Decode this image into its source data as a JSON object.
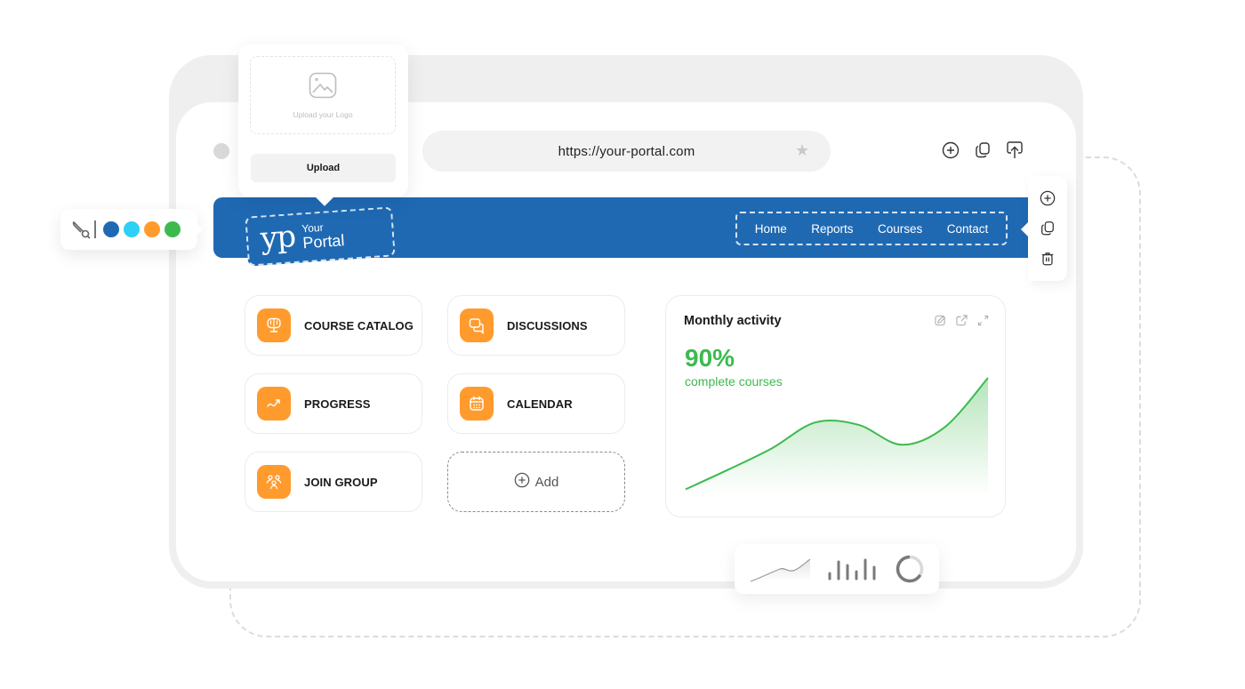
{
  "browser": {
    "url": "https://your-portal.com",
    "actions": [
      "add-icon",
      "copy-icon",
      "share-icon"
    ]
  },
  "upload_popover": {
    "hint": "Upload your Logo",
    "button_label": "Upload"
  },
  "palette": {
    "colors": [
      "#1f69b3",
      "#2ed0f5",
      "#ff9b2d",
      "#3dba4e"
    ]
  },
  "logo": {
    "mark": "yp",
    "line1": "Your",
    "line2": "Portal"
  },
  "nav": {
    "links": [
      "Home",
      "Reports",
      "Courses",
      "Contact"
    ]
  },
  "side_toolbar": {
    "actions": [
      "add-icon",
      "copy-icon",
      "delete-icon"
    ]
  },
  "tiles": [
    {
      "label": "COURSE CATALOG",
      "icon": "monitor-book-icon"
    },
    {
      "label": "DISCUSSIONS",
      "icon": "chat-icon"
    },
    {
      "label": "PROGRESS",
      "icon": "trend-up-icon"
    },
    {
      "label": "CALENDAR",
      "icon": "calendar-icon"
    },
    {
      "label": "JOIN GROUP",
      "icon": "group-icon"
    }
  ],
  "add_tile": {
    "label": "Add"
  },
  "activity_card": {
    "title": "Monthly activity",
    "value": "90%",
    "caption": "complete courses",
    "accent": "#3dba4e"
  },
  "chart_data": {
    "type": "area",
    "title": "Monthly activity",
    "x": [
      0,
      1,
      2,
      3,
      4,
      5,
      6,
      7
    ],
    "values": [
      5,
      22,
      40,
      62,
      60,
      43,
      58,
      100
    ],
    "ylim": [
      0,
      100
    ],
    "grid": false,
    "xlabel": "",
    "ylabel": ""
  },
  "chart_switcher": {
    "options": [
      "line-chart-icon",
      "bar-chart-icon",
      "donut-chart-icon"
    ]
  }
}
